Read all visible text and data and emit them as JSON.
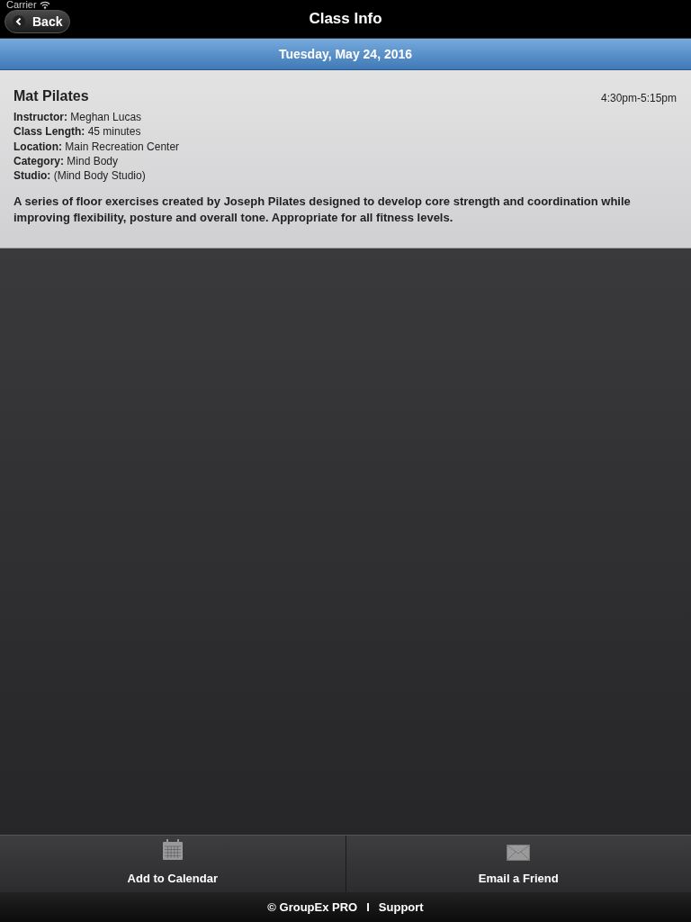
{
  "status_bar": {
    "carrier": "Carrier"
  },
  "nav_bar": {
    "back": "Back",
    "title": "Class Info"
  },
  "date_header": "Tuesday, May 24, 2016",
  "class": {
    "name": "Mat Pilates",
    "time": "4:30pm-5:15pm",
    "details": [
      "**Instructor:** Meghan Lucas",
      "**Class Length:** 45 minutes",
      "**Location:** Main Recreation Center",
      "**Category:** Mind Body",
      "**Studio:** (Mind Body Studio)"
    ],
    "description": "A series of floor exercises created by Joseph Pilates designed to develop core strength and coordination while improving flexibility, posture and overall tone. Appropriate for all fitness levels."
  },
  "actions": [
    {
      "kind": "calendar",
      "label": "Add to Calendar"
    },
    {
      "kind": "email",
      "label": "Email a Friend"
    }
  ],
  "footer": {
    "copyright": "© GroupEx PRO",
    "separator": "I",
    "link": "Support"
  }
}
